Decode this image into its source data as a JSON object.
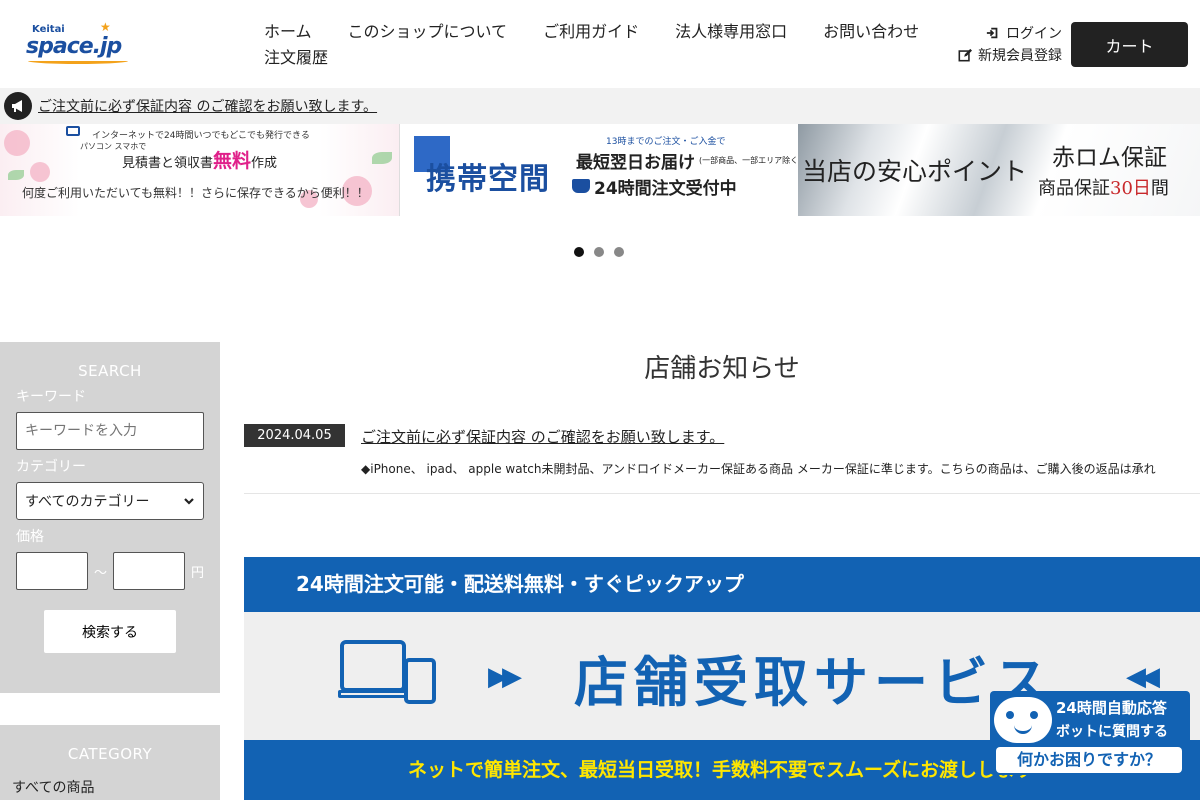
{
  "header": {
    "logo_small": "Keitai",
    "logo_main": "space.jp",
    "nav_row1": [
      "ホーム",
      "このショップについて",
      "ご利用ガイド",
      "法人様専用窓口",
      "お問い合わせ"
    ],
    "nav_row2": [
      "注文履歴"
    ],
    "login": "ログイン",
    "register": "新規会員登録",
    "cart": "カート"
  },
  "notice": {
    "text": "ご注文前に必ず保証内容 のご確認をお願い致します。"
  },
  "banners": {
    "b1_line1": "インターネットで24時間いつでもどこでも発行できる",
    "b1_devices": "パソコン スマホで",
    "b1_line2": "見積書と領収書",
    "b1_free": "無料",
    "b1_made": "作成",
    "b1_line3": "何度ご利用いただいても無料！！さらに保存できるから便利！！",
    "b2_brand": "携帯空間",
    "b2_small": "13時までのご注文・ご入金で",
    "b2_line1": "最短翌日お届け",
    "b2_note": "(一部商品、一部エリア除く)",
    "b2_line2": "24時間注文受付中",
    "b3_left": "当店の安心ポイント",
    "b3_right1": "赤ロム保証",
    "b3_right2a": "商品保証",
    "b3_right2b": "30日",
    "b3_right2c": "間"
  },
  "slider": {
    "active_index": 0,
    "count": 3
  },
  "sidebar": {
    "search_title": "SEARCH",
    "keyword_label": "キーワード",
    "keyword_placeholder": "キーワードを入力",
    "category_label": "カテゴリー",
    "category_value": "すべてのカテゴリー",
    "price_label": "価格",
    "price_sep": "～",
    "price_unit": "円",
    "search_button": "検索する",
    "category_title": "CATEGORY",
    "category_items": [
      "すべての商品"
    ]
  },
  "news": {
    "title": "店舗お知らせ",
    "items": [
      {
        "date": "2024.04.05",
        "title": "ご注文前に必ず保証内容 のご確認をお願い致します。",
        "body": "◆iPhone、 ipad、 apple watch未開封品、アンドロイドメーカー保証ある商品 メーカー保証に準じます。こちらの商品は、ご購入後の返品は承れ"
      }
    ]
  },
  "pickup": {
    "top": "24時間注文可能・配送料無料・すぐピックアップ",
    "service": "店舗受取サービス",
    "bottom": "ネットで簡単注文、最短当日受取！手数料不要でスムーズにお渡しします"
  },
  "chatbot": {
    "line1": "24時間自動応答",
    "line2": "ボットに質問する",
    "bubble": "何かお困りですか？"
  },
  "colors": {
    "accent_blue": "#1262b3",
    "dark": "#222222",
    "sidebar_gray": "#d4d4d4",
    "free_pink": "#e0208a"
  }
}
